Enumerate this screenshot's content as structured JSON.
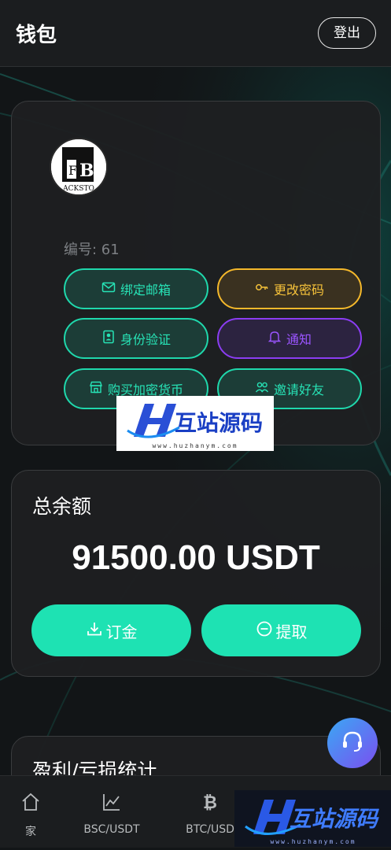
{
  "header": {
    "title": "钱包",
    "logout_label": "登出"
  },
  "profile": {
    "avatar_text": "ACKSTO",
    "uid_text": "编号: 61",
    "actions": [
      {
        "label": "绑定邮箱",
        "icon": "mail-icon"
      },
      {
        "label": "更改密码",
        "icon": "key-icon"
      },
      {
        "label": "身份验证",
        "icon": "id-card-icon"
      },
      {
        "label": "通知",
        "icon": "bell-icon"
      },
      {
        "label": "购买加密货币",
        "icon": "store-icon"
      },
      {
        "label": "邀请好友",
        "icon": "users-icon"
      }
    ]
  },
  "watermark": {
    "text": "互站源码",
    "url": "www.huzhanym.com"
  },
  "balance": {
    "label": "总余额",
    "amount": "91500.00 USDT",
    "deposit_label": "订金",
    "withdraw_label": "提取"
  },
  "stats": {
    "title": "盈利/亏损统计"
  },
  "tabbar": {
    "items": [
      {
        "label": "家",
        "icon": "home-icon"
      },
      {
        "label": "BSC/USDT",
        "icon": "chart-icon"
      },
      {
        "label": "BTC/USD",
        "icon": "bitcoin-icon"
      }
    ]
  },
  "colors": {
    "accent": "#1ee2b3",
    "gold": "#f4b82b",
    "purple": "#8b3df2",
    "background": "#121517",
    "card": "#1e1f21"
  }
}
